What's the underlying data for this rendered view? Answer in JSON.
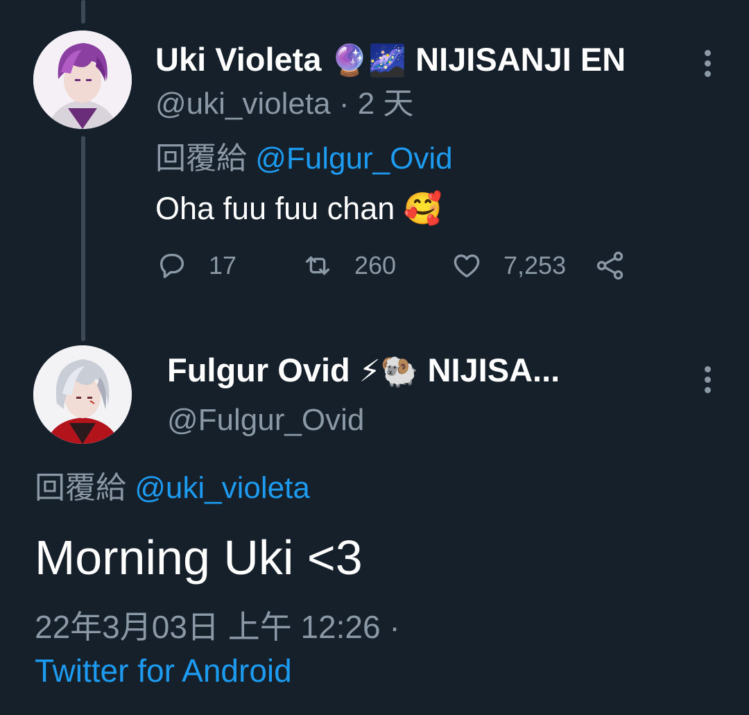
{
  "reply_tweet": {
    "display_name": "Uki Violeta",
    "name_emojis": "🔮🌌",
    "name_suffix": "NIJISANJI EN",
    "handle": "@uki_violeta",
    "separator": "·",
    "time_ago": "2 天",
    "reply_prefix": "回覆給",
    "reply_mention": "@Fulgur_Ovid",
    "text": "Oha fuu fuu chan",
    "text_emoji": "🥰",
    "replies": "17",
    "retweets": "260",
    "likes": "7,253",
    "avatar_icon": "uki-avatar"
  },
  "main_tweet": {
    "display_name": "Fulgur Ovid",
    "name_emojis": "⚡🐏",
    "name_suffix": "NIJISA...",
    "handle": "@Fulgur_Ovid",
    "reply_prefix": "回覆給",
    "reply_mention": "@uki_violeta",
    "text": "Morning Uki <3",
    "timestamp": "22年3月03日 上午 12:26 ·",
    "source": "Twitter for Android",
    "avatar_icon": "fulgur-avatar"
  },
  "colors": {
    "background": "#15202b",
    "secondary_text": "#8b98a5",
    "link": "#1d9bf0",
    "thread_line": "#3d4a56"
  }
}
